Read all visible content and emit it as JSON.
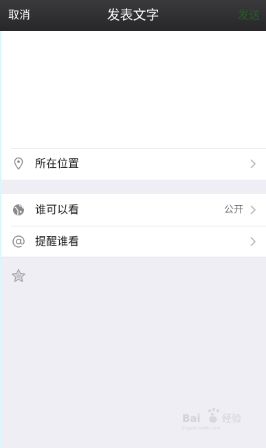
{
  "nav": {
    "cancel_label": "取消",
    "title": "发表文字",
    "send_label": "发送"
  },
  "compose": {
    "value": "",
    "placeholder": ""
  },
  "rows": {
    "location": {
      "label": "所在位置",
      "icon": "location-pin-icon"
    },
    "visibility": {
      "label": "谁可以看",
      "value": "公开",
      "icon": "globe-icon"
    },
    "mention": {
      "label": "提醒谁看",
      "icon": "at-sign-icon"
    }
  },
  "star_icon": "star-icon",
  "watermark": {
    "text": "Baidu经验"
  },
  "colors": {
    "nav_bg": "#2e2e30",
    "nav_text": "#ffffff",
    "send_disabled": "#2a5a2b",
    "page_bg": "#efeef4",
    "row_bg": "#ffffff",
    "secondary_text": "#6f6f74",
    "icon_gray": "#8a8a8f"
  }
}
